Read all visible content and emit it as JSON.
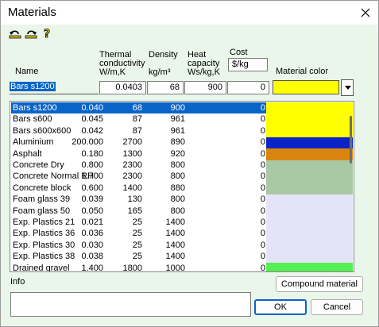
{
  "window": {
    "title": "Materials"
  },
  "toolbar": {
    "icons": [
      "undo-arrow-icon",
      "redo-arrow-icon",
      "help-question-icon"
    ]
  },
  "headers": {
    "name": "Name",
    "thermal_l1": "Thermal",
    "thermal_l2": "conductivity",
    "thermal_l3": "W/m,K",
    "density_l1": "Density",
    "density_l2": "kg/m³",
    "heat_l1": "Heat",
    "heat_l2": "capacity",
    "heat_l3": "Ws/kg,K",
    "cost_l1": "Cost",
    "cost_l2": "$/kg",
    "color": "Material color"
  },
  "editor": {
    "name": "Bars s1200",
    "conductivity": "0.0403",
    "density": "68",
    "heat_capacity": "900",
    "cost": "0",
    "color": "#ffff00"
  },
  "materials": [
    {
      "name": "Bars s1200",
      "k": "0.040",
      "density": "68",
      "heat": "900",
      "cost": "0",
      "color": "#ffff00",
      "selected": true
    },
    {
      "name": "Bars s600",
      "k": "0.045",
      "density": "87",
      "heat": "961",
      "cost": "0",
      "color": "#ffff00"
    },
    {
      "name": "Bars s600x600",
      "k": "0.042",
      "density": "87",
      "heat": "961",
      "cost": "0",
      "color": "#ffff00"
    },
    {
      "name": "Aluminium",
      "k": "200.000",
      "density": "2700",
      "heat": "890",
      "cost": "0",
      "color": "#0a24c8"
    },
    {
      "name": "Asphalt",
      "k": "0.180",
      "density": "1300",
      "heat": "920",
      "cost": "0",
      "color": "#d9850f"
    },
    {
      "name": "Concrete Dry",
      "k": "0.800",
      "density": "2300",
      "heat": "800",
      "cost": "0",
      "color": "#a9c9a4"
    },
    {
      "name": "Concrete Normal RH",
      "k": "1.700",
      "density": "2300",
      "heat": "800",
      "cost": "0",
      "color": "#a9c9a4"
    },
    {
      "name": "Concrete block",
      "k": "0.600",
      "density": "1400",
      "heat": "880",
      "cost": "0",
      "color": "#a9c9a4"
    },
    {
      "name": "Foam glass 39",
      "k": "0.039",
      "density": "130",
      "heat": "800",
      "cost": "0",
      "color": "#e4e4f8"
    },
    {
      "name": "Foam glass 50",
      "k": "0.050",
      "density": "165",
      "heat": "800",
      "cost": "0",
      "color": "#e4e4f8"
    },
    {
      "name": "Exp. Plastics 21",
      "k": "0.021",
      "density": "25",
      "heat": "1400",
      "cost": "0",
      "color": "#e4e4f8"
    },
    {
      "name": "Exp. Plastics 36",
      "k": "0.036",
      "density": "25",
      "heat": "1400",
      "cost": "0",
      "color": "#e4e4f8"
    },
    {
      "name": "Exp. Plastics 30",
      "k": "0.030",
      "density": "25",
      "heat": "1400",
      "cost": "0",
      "color": "#e4e4f8"
    },
    {
      "name": "Exp. Plastics 38",
      "k": "0.038",
      "density": "25",
      "heat": "1400",
      "cost": "0",
      "color": "#e4e4f8"
    },
    {
      "name": "Drained gravel",
      "k": "1.400",
      "density": "1800",
      "heat": "1000",
      "cost": "0",
      "color": "#55ee55"
    }
  ],
  "info": {
    "label": "Info",
    "value": ""
  },
  "buttons": {
    "compound": "Compound material",
    "ok": "OK",
    "cancel": "Cancel"
  },
  "colors": {
    "accent": "#0a64c8",
    "window_bg": "#eaf6ea"
  }
}
